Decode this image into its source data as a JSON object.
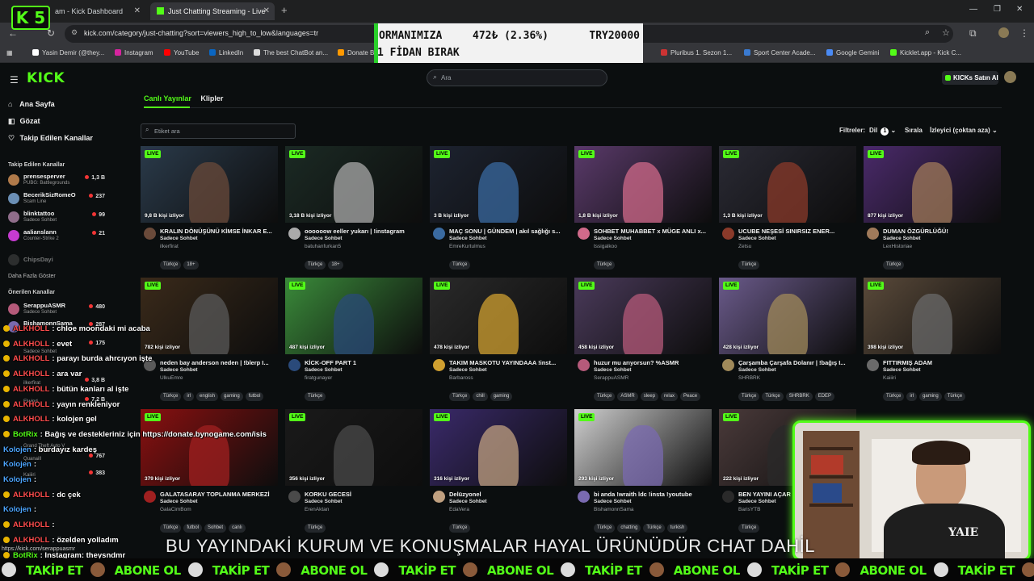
{
  "browser": {
    "tabs": [
      {
        "title": "am - Kick Dashboard"
      },
      {
        "title": "Just Chatting Streaming - Live"
      }
    ],
    "url": "kick.com/category/just-chatting?sort=viewers_high_to_low&languages=tr",
    "bookmarks": [
      "Yasin Demir (@they...",
      "Instagram",
      "YouTube",
      "LinkedIn",
      "The best ChatBot an...",
      "Donate B",
      "Pluribus 1. Sezon 1...",
      "Sport Center Acade...",
      "Google Gemini",
      "Kicklet.app - Kick C..."
    ]
  },
  "stream_logo": "K 5",
  "donation": {
    "line1": "ORMANIMIZA",
    "progress": "472₺ (2.36%)",
    "goal": "TRY20000",
    "line2": "1 FİDAN BIRAK",
    "accent": "#2ad02a"
  },
  "kick": {
    "brand": "KICK",
    "brand_color": "#53fc18",
    "search_placeholder": "Ara",
    "buy_kicks": "KICKs Satın Al"
  },
  "sidebar": {
    "nav": [
      {
        "label": "Ana Sayfa",
        "icon": "home-icon"
      },
      {
        "label": "Gözat",
        "icon": "compass-icon"
      },
      {
        "label": "Takip Edilen Kanallar",
        "icon": "heart-icon"
      }
    ],
    "followed_title": "Takip Edilen Kanallar",
    "followed": [
      {
        "name": "prensesperver",
        "game": "PUBG: Battlegrounds",
        "viewers": "1,3 B",
        "color": "#b07a4a"
      },
      {
        "name": "BecerikSizRomeO",
        "game": "Scam Line",
        "viewers": "237",
        "color": "#6b8fb5"
      },
      {
        "name": "blinktattoo",
        "game": "Sadece Sohbet",
        "viewers": "99",
        "color": "#8f6d8a"
      },
      {
        "name": "aalianslann",
        "game": "Counter-Strike 2",
        "viewers": "21",
        "color": "#c53bd0"
      },
      {
        "name": "ChipsDayi",
        "game": "",
        "viewers": "",
        "color": "#555555"
      }
    ],
    "show_more": "Daha Fazla Göster",
    "recommended_title": "Önerilen Kanallar",
    "recommended": [
      {
        "name": "SerappuASMR",
        "game": "Sadece Sohbet",
        "viewers": "480",
        "color": "#b55a7a"
      },
      {
        "name": "BishamonnSama",
        "game": "",
        "viewers": "287",
        "color": "#7a6ab0"
      }
    ],
    "partial_values": [
      "175",
      "3,8 B",
      "7,2 B",
      "767",
      "383"
    ],
    "partial_names": [
      "Sadece Sohbet",
      "ilkerfirat",
      "Elwind",
      "Grand Theft Auto V",
      "Quanaill",
      "Kaiiiri"
    ]
  },
  "main": {
    "tabs": [
      "Canlı Yayınlar",
      "Klipler"
    ],
    "tag_search_placeholder": "Etiket ara",
    "filters_label": "Filtreler:",
    "lang_label": "Dil",
    "lang_count": "1",
    "sort_label": "Sırala",
    "sort_value": "İzleyici (çoktan aza)",
    "live_badge": "LIVE"
  },
  "cards": [
    {
      "viewers": "9,8 B kişi izliyor",
      "title": "KRALIN DÖNÜŞÜNÜ KİMSE İNKAR E...",
      "category": "Sadece Sohbet",
      "channel": "ilkerfirat",
      "tags": [
        "Türkçe",
        "18+"
      ],
      "bg": "#2a3a4a",
      "av": "#6a4a3a"
    },
    {
      "viewers": "3,18 B kişi izliyor",
      "title": "oooooow eeller yukarı | !instagram",
      "category": "Sadece Sohbet",
      "channel": "batuhanfurkan5",
      "tags": [
        "Türkçe",
        "18+"
      ],
      "bg": "#1b2a24",
      "av": "#aaaaaa"
    },
    {
      "viewers": "3 B kişi izliyor",
      "title": "MAÇ SONU | GÜNDEM | akıl sağlığı s...",
      "category": "Sadece Sohbet",
      "channel": "EmreKurtulmus",
      "tags": [
        "Türkçe"
      ],
      "bg": "#1d2330",
      "av": "#3a6aa0"
    },
    {
      "viewers": "1,8 B kişi izliyor",
      "title": "SOHBET MUHABBET x MÜGE ANLI x...",
      "category": "Sadece Sohbet",
      "channel": "tssigalkoo",
      "tags": [
        "Türkçe"
      ],
      "bg": "#5a3a6a",
      "av": "#d06a8a"
    },
    {
      "viewers": "1,3 B kişi izliyor",
      "title": "UCUBE NEŞESİ SINIRSIZ ENER...",
      "category": "Sadece Sohbet",
      "channel": "Zetsu",
      "tags": [
        "Türkçe"
      ],
      "bg": "#2a2a34",
      "av": "#8a3a2a"
    },
    {
      "viewers": "877 kişi izliyor",
      "title": "DUMAN ÖZGÜRLÜĞÜ!",
      "category": "Sadece Sohbet",
      "channel": "LexHistoriae",
      "tags": [
        "Türkçe"
      ],
      "bg": "#4a2a6a",
      "av": "#a07a5a"
    },
    {
      "viewers": "782 kişi izliyor",
      "title": "neden bay anderson neden | !blerp I...",
      "category": "Sadece Sohbet",
      "channel": "UlkuEmre",
      "tags": [
        "Türkçe",
        "irl",
        "english",
        "gaming",
        "futbol"
      ],
      "bg": "#3a2a1a",
      "av": "#5a5a5a"
    },
    {
      "viewers": "487 kişi izliyor",
      "title": "KİCK-OFF PART 1",
      "category": "Sadece Sohbet",
      "channel": "firatgunayer",
      "tags": [
        "Türkçe"
      ],
      "bg": "#3a8a3a",
      "av": "#2a4a7a"
    },
    {
      "viewers": "478 kişi izliyor",
      "title": "TAKIM MASKOTU YAYINDAAA !inst...",
      "category": "Sadece Sohbet",
      "channel": "Barbaross",
      "tags": [
        "Türkçe",
        "chill",
        "gaming"
      ],
      "bg": "#2a2a2a",
      "av": "#d0a030"
    },
    {
      "viewers": "458 kişi izliyor",
      "title": "huzur mu arıyorsun? %ASMR",
      "category": "Sadece Sohbet",
      "channel": "SerappuASMR",
      "tags": [
        "Türkçe",
        "ASMR",
        "sleep",
        "relax",
        "Peace"
      ],
      "bg": "#4a3a5a",
      "av": "#b55a7a"
    },
    {
      "viewers": "428 kişi izliyor",
      "title": "Çarşamba Çarşafa Dolanır | !bağış I...",
      "category": "Sadece Sohbet",
      "channel": "SHRBRK",
      "tags": [
        "Türkçe",
        "Türkçe",
        "SHRBRK",
        "EDEP"
      ],
      "bg": "#6a5a8a",
      "av": "#a08a5a"
    },
    {
      "viewers": "398 kişi izliyor",
      "title": "FITTIRMIŞ ADAM",
      "category": "Sadece Sohbet",
      "channel": "Kaiiiri",
      "tags": [
        "Türkçe",
        "irl",
        "gaming",
        "Türkçe"
      ],
      "bg": "#5a4a3a",
      "av": "#6a6a6a"
    },
    {
      "viewers": "379 kişi izliyor",
      "title": "GALATASARAY TOPLANMA MERKEZİ",
      "category": "Sadece Sohbet",
      "channel": "GalaCimBom",
      "tags": [
        "Türkçe",
        "futbol",
        "Sohbet",
        "canlı"
      ],
      "bg": "#8a1010",
      "av": "#a02020"
    },
    {
      "viewers": "356 kişi izliyor",
      "title": "KORKU GECESİ",
      "category": "Sadece Sohbet",
      "channel": "ErenAktan",
      "tags": [
        "Türkçe"
      ],
      "bg": "#1a1a1a",
      "av": "#4a4a4a"
    },
    {
      "viewers": "316 kişi izliyor",
      "title": "Delüzyonel",
      "category": "Sadece Sohbet",
      "channel": "EdaVera",
      "tags": [
        "Türkçe"
      ],
      "bg": "#3a2a6a",
      "av": "#c0a080"
    },
    {
      "viewers": "293 kişi izliyor",
      "title": "bi anda !wraith ldc !insta !youtube",
      "category": "Sadece Sohbet",
      "channel": "BishamonnSama",
      "tags": [
        "Türkçe",
        "chatting",
        "Türkçe",
        "turkish"
      ],
      "bg": "#cfcfcf",
      "av": "#7a6ab0"
    },
    {
      "viewers": "222 kişi izliyor",
      "title": "BEN YAYINI AÇAR",
      "category": "Sadece Sohbet",
      "channel": "BarisYTB",
      "tags": [
        "Türkçe"
      ],
      "bg": "#4a3a3a",
      "av": "#2a2a2a"
    }
  ],
  "chat": [
    {
      "user": "ALKHOLL",
      "text": ": chloe moondaki mi acaba",
      "color": "#ff4d4d",
      "badge": true
    },
    {
      "user": "ALKHOLL",
      "text": ": evet",
      "color": "#ff4d4d",
      "badge": true
    },
    {
      "user": "ALKHOLL",
      "text": ": parayı burda ahrcıyon işte",
      "color": "#ff4d4d",
      "badge": true
    },
    {
      "user": "ALKHOLL",
      "text": ": ara var",
      "color": "#ff4d4d",
      "badge": true
    },
    {
      "user": "ALKHOLL",
      "text": ": bütün kanları al işte",
      "color": "#ff4d4d",
      "badge": true
    },
    {
      "user": "ALKHOLL",
      "text": ": yayın renkleniyor",
      "color": "#ff4d4d",
      "badge": true
    },
    {
      "user": "ALKHOLL",
      "text": ": kolojen gel",
      "color": "#ff4d4d",
      "badge": true
    },
    {
      "user": "BotRix",
      "text": ": Bağış ve destekleriniz için https://donate.bynogame.com/isis",
      "color": "#53fc18",
      "badge": true
    },
    {
      "user": "Kolojen",
      "text": ": burdayız kardeş",
      "color": "#4da6ff",
      "badge": false
    },
    {
      "user": "Kolojen",
      "text": ":",
      "color": "#4da6ff",
      "badge": false
    },
    {
      "user": "Kolojen",
      "text": ":",
      "color": "#4da6ff",
      "badge": false
    },
    {
      "user": "ALKHOLL",
      "text": ": dc çek",
      "color": "#ff4d4d",
      "badge": true
    },
    {
      "user": "Kolojen",
      "text": ":",
      "color": "#4da6ff",
      "badge": false
    },
    {
      "user": "ALKHOLL",
      "text": ":",
      "color": "#ff4d4d",
      "badge": true
    },
    {
      "user": "ALKHOLL",
      "text": ": özelden yolladım",
      "color": "#ff4d4d",
      "badge": true
    },
    {
      "user": "BotRix",
      "text": ": Instagram: theysndmr",
      "color": "#53fc18",
      "badge": true
    }
  ],
  "status_url": "https://kick.com/serappuasmr",
  "subtitle": "BU YAYINDAKİ KURUM VE KONUŞMALAR HAYAL ÜRÜNÜDÜR CHAT DAHİL",
  "ticker": [
    "TAKİP ET",
    "ABONE OL",
    "TAKİP ET",
    "ABONE OL",
    "TAKİP ET",
    "ABONE OL",
    "TAKİP ET",
    "ABONE OL",
    "TAKİP ET",
    "ABONE OL",
    "TAKİP ET",
    "ABONE OL",
    "TAKİP ET",
    "ABONE OL"
  ]
}
